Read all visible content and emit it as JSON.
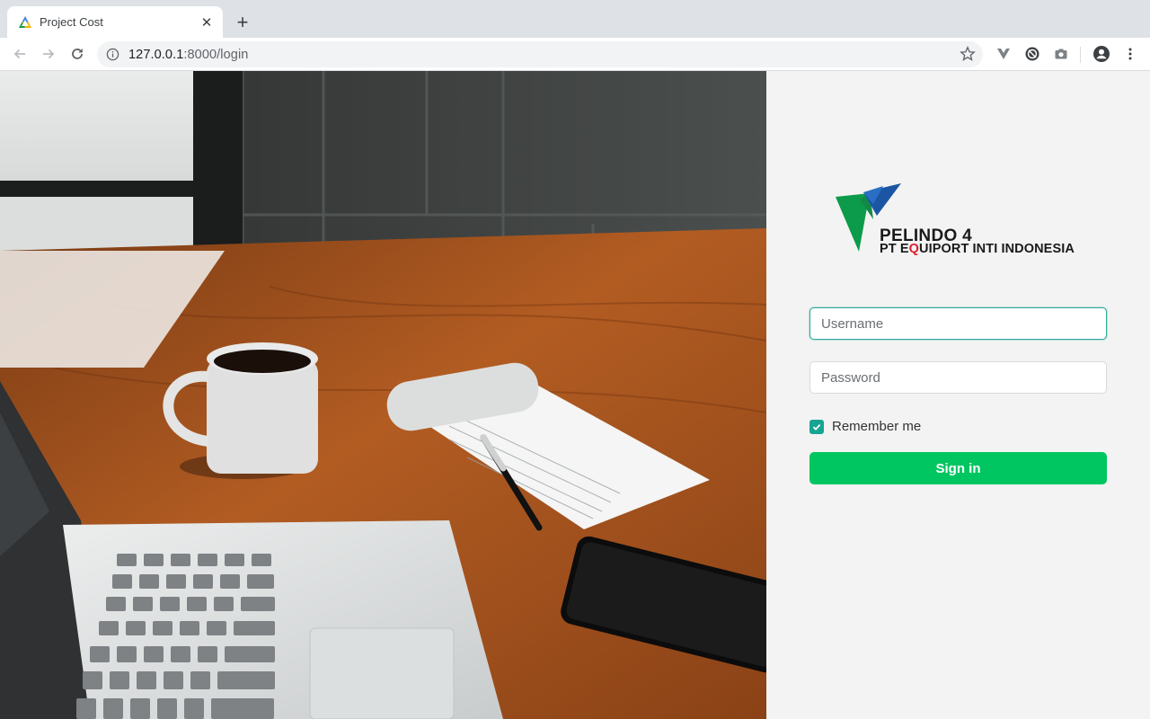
{
  "browser": {
    "tab_title": "Project Cost",
    "url_host": "127.0.0.1",
    "url_rest": ":8000/login",
    "icons": {
      "favicon": "triangle-logo-icon",
      "close": "close-icon",
      "new_tab": "plus-icon",
      "back": "back-arrow-icon",
      "forward": "forward-arrow-icon",
      "reload": "reload-icon",
      "site_info": "info-icon",
      "bookmark": "star-icon",
      "extensions": [
        "vue-devtools-icon",
        "shield-icon",
        "camera-icon"
      ],
      "profile": "account-icon",
      "menu": "kebab-menu-icon"
    }
  },
  "hero": {
    "image": "desk-with-laptop-coffee-notepad-phone"
  },
  "login": {
    "logo_title": "PELINDO 4",
    "logo_sub_before": "PT E",
    "logo_sub_highlight": "Q",
    "logo_sub_after": "UIPORT INTI INDONESIA",
    "username_placeholder": "Username",
    "password_placeholder": "Password",
    "remember_label": "Remember me",
    "remember_checked": true,
    "signin_label": "Sign in"
  },
  "colors": {
    "accent_teal": "#17a493",
    "signin_green": "#00c661",
    "logo_green": "#0c9b4a",
    "logo_blue": "#1b56a5",
    "logo_red": "#d9212b"
  }
}
